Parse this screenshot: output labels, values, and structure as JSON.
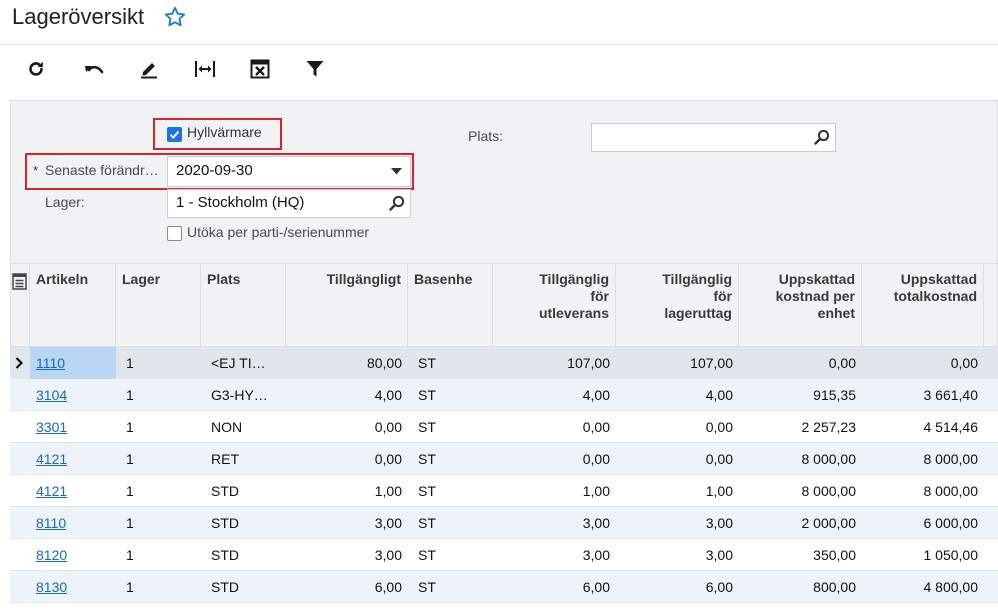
{
  "header": {
    "title": "Lageröversikt"
  },
  "toolbar": {
    "buttons": [
      {
        "name": "refresh-button",
        "icon": "refresh-icon"
      },
      {
        "name": "undo-button",
        "icon": "undo-icon"
      },
      {
        "name": "edit-button",
        "icon": "pencil-icon"
      },
      {
        "name": "fit-columns-button",
        "icon": "fit-width-icon"
      },
      {
        "name": "export-excel-button",
        "icon": "excel-icon"
      },
      {
        "name": "filter-button",
        "icon": "filter-icon"
      }
    ]
  },
  "form": {
    "hyllvarmare_label": "Hyllvärmare",
    "hyllvarmare_checked": true,
    "senaste_label": "Senaste förändr…",
    "senaste_value": "2020-09-30",
    "lager_label": "Lager:",
    "lager_value": "1 - Stockholm (HQ)",
    "plats_label": "Plats:",
    "plats_value": "",
    "utoka_label": "Utöka per parti-/serienummer",
    "utoka_checked": false
  },
  "grid": {
    "columns": [
      "Artikeln",
      "Lager",
      "Plats",
      "Tillgängligt",
      "Basenhe",
      "Tillgänglig\nför\nutleverans",
      "Tillgänglig\nför\nlageruttag",
      "Uppskattad\nkostnad per\nenhet",
      "Uppskattad\ntotalkostnad"
    ],
    "rows": [
      {
        "artikel": "1110",
        "lager": "1",
        "plats": "<EJ TI…",
        "tillgangligt": "80,00",
        "basenhet": "ST",
        "utleverans": "107,00",
        "lageruttag": "107,00",
        "kostnad_enhet": "0,00",
        "totalkostnad": "0,00"
      },
      {
        "artikel": "3104",
        "lager": "1",
        "plats": "G3-HY…",
        "tillgangligt": "4,00",
        "basenhet": "ST",
        "utleverans": "4,00",
        "lageruttag": "4,00",
        "kostnad_enhet": "915,35",
        "totalkostnad": "3 661,40"
      },
      {
        "artikel": "3301",
        "lager": "1",
        "plats": "NON",
        "tillgangligt": "0,00",
        "basenhet": "ST",
        "utleverans": "0,00",
        "lageruttag": "0,00",
        "kostnad_enhet": "2 257,23",
        "totalkostnad": "4 514,46"
      },
      {
        "artikel": "4121",
        "lager": "1",
        "plats": "RET",
        "tillgangligt": "0,00",
        "basenhet": "ST",
        "utleverans": "0,00",
        "lageruttag": "0,00",
        "kostnad_enhet": "8 000,00",
        "totalkostnad": "8 000,00"
      },
      {
        "artikel": "4121",
        "lager": "1",
        "plats": "STD",
        "tillgangligt": "1,00",
        "basenhet": "ST",
        "utleverans": "1,00",
        "lageruttag": "1,00",
        "kostnad_enhet": "8 000,00",
        "totalkostnad": "8 000,00"
      },
      {
        "artikel": "8110",
        "lager": "1",
        "plats": "STD",
        "tillgangligt": "3,00",
        "basenhet": "ST",
        "utleverans": "3,00",
        "lageruttag": "3,00",
        "kostnad_enhet": "2 000,00",
        "totalkostnad": "6 000,00"
      },
      {
        "artikel": "8120",
        "lager": "1",
        "plats": "STD",
        "tillgangligt": "3,00",
        "basenhet": "ST",
        "utleverans": "3,00",
        "lageruttag": "3,00",
        "kostnad_enhet": "350,00",
        "totalkostnad": "1 050,00"
      },
      {
        "artikel": "8130",
        "lager": "1",
        "plats": "STD",
        "tillgangligt": "6,00",
        "basenhet": "ST",
        "utleverans": "6,00",
        "lageruttag": "6,00",
        "kostnad_enhet": "800,00",
        "totalkostnad": "4 800,00"
      }
    ]
  },
  "colors": {
    "accent": "#1a73e8",
    "link": "#1769c8",
    "highlight_box": "#d9232e",
    "selected_cell": "#b9d6f2",
    "row_alt": "#eef3fa"
  }
}
